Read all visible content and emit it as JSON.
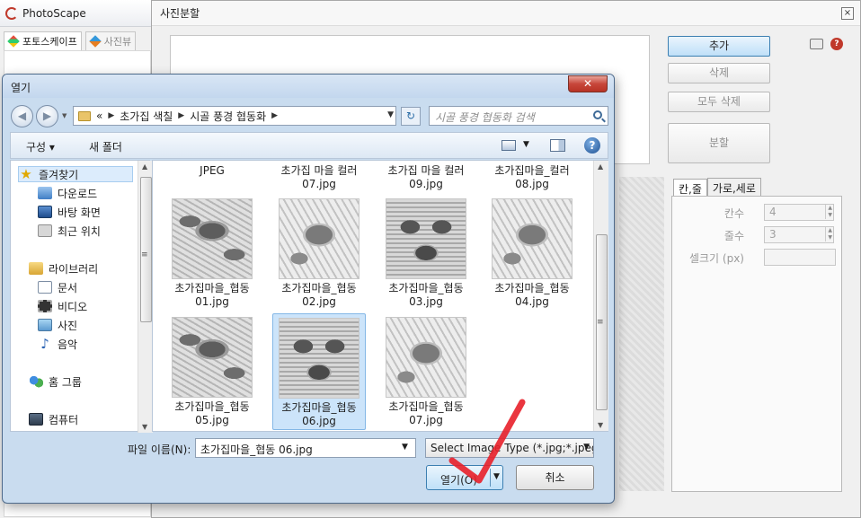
{
  "photoscape": {
    "title": "PhotoScape",
    "tabs": [
      "포토스케이프",
      "사진뷰"
    ]
  },
  "split_window": {
    "title": "사진분할",
    "close_glyph": "×",
    "buttons": {
      "add": "추가",
      "delete": "삭제",
      "delete_all": "모두 삭제",
      "split": "분할"
    },
    "tabs": [
      "칸,줄",
      "가로,세로"
    ],
    "fields": {
      "columns": {
        "label": "칸수",
        "value": "4"
      },
      "rows": {
        "label": "줄수",
        "value": "3"
      },
      "cell_size": {
        "label": "셀크기 (px)",
        "value": ""
      }
    }
  },
  "dialog": {
    "title": "열기",
    "close_glyph": "✕",
    "breadcrumb": [
      "«",
      "초가집 색칠",
      "시골 풍경 협동화"
    ],
    "search_placeholder": "시골 풍경 협동화 검색",
    "toolbar": {
      "organize": "구성 ▾",
      "new_folder": "새 폴더",
      "help": "?"
    },
    "nav": {
      "favorites": "즐겨찾기",
      "downloads": "다운로드",
      "desktop": "바탕 화면",
      "recent": "최근 위치",
      "libraries": "라이브러리",
      "documents": "문서",
      "videos": "비디오",
      "pictures": "사진",
      "music": "음악",
      "homegroup": "홈 그룹",
      "computer": "컴퓨터"
    },
    "partial_files": [
      {
        "name": "JPEG"
      },
      {
        "name": "초가집 마을 컬러 07.jpg"
      },
      {
        "name": "초가집 마을 컬러 09.jpg"
      },
      {
        "name": "초가집마을_컬러 08.jpg"
      }
    ],
    "files": [
      {
        "line1": "초가집마을_협동",
        "line2": "01.jpg"
      },
      {
        "line1": "초가집마을_협동",
        "line2": "02.jpg"
      },
      {
        "line1": "초가집마을_협동",
        "line2": "03.jpg"
      },
      {
        "line1": "초가집마을_협동",
        "line2": "04.jpg"
      },
      {
        "line1": "초가집마을_협동",
        "line2": "05.jpg"
      },
      {
        "line1": "초가집마을_협동",
        "line2": "06.jpg",
        "selected": true
      },
      {
        "line1": "초가집마을_협동",
        "line2": "07.jpg"
      }
    ],
    "filename_label": "파일 이름(N):",
    "filename_value": "초가집마을_협동 06.jpg",
    "file_type": "Select Image Type   (*.jpg;*.jpeg",
    "open_button": "열기(O)",
    "cancel_button": "취소"
  },
  "colors": {
    "accent_blue": "#3c7fb1",
    "selection": "#cce4fa",
    "close_red": "#c7463a",
    "check_red": "#e8202a"
  }
}
